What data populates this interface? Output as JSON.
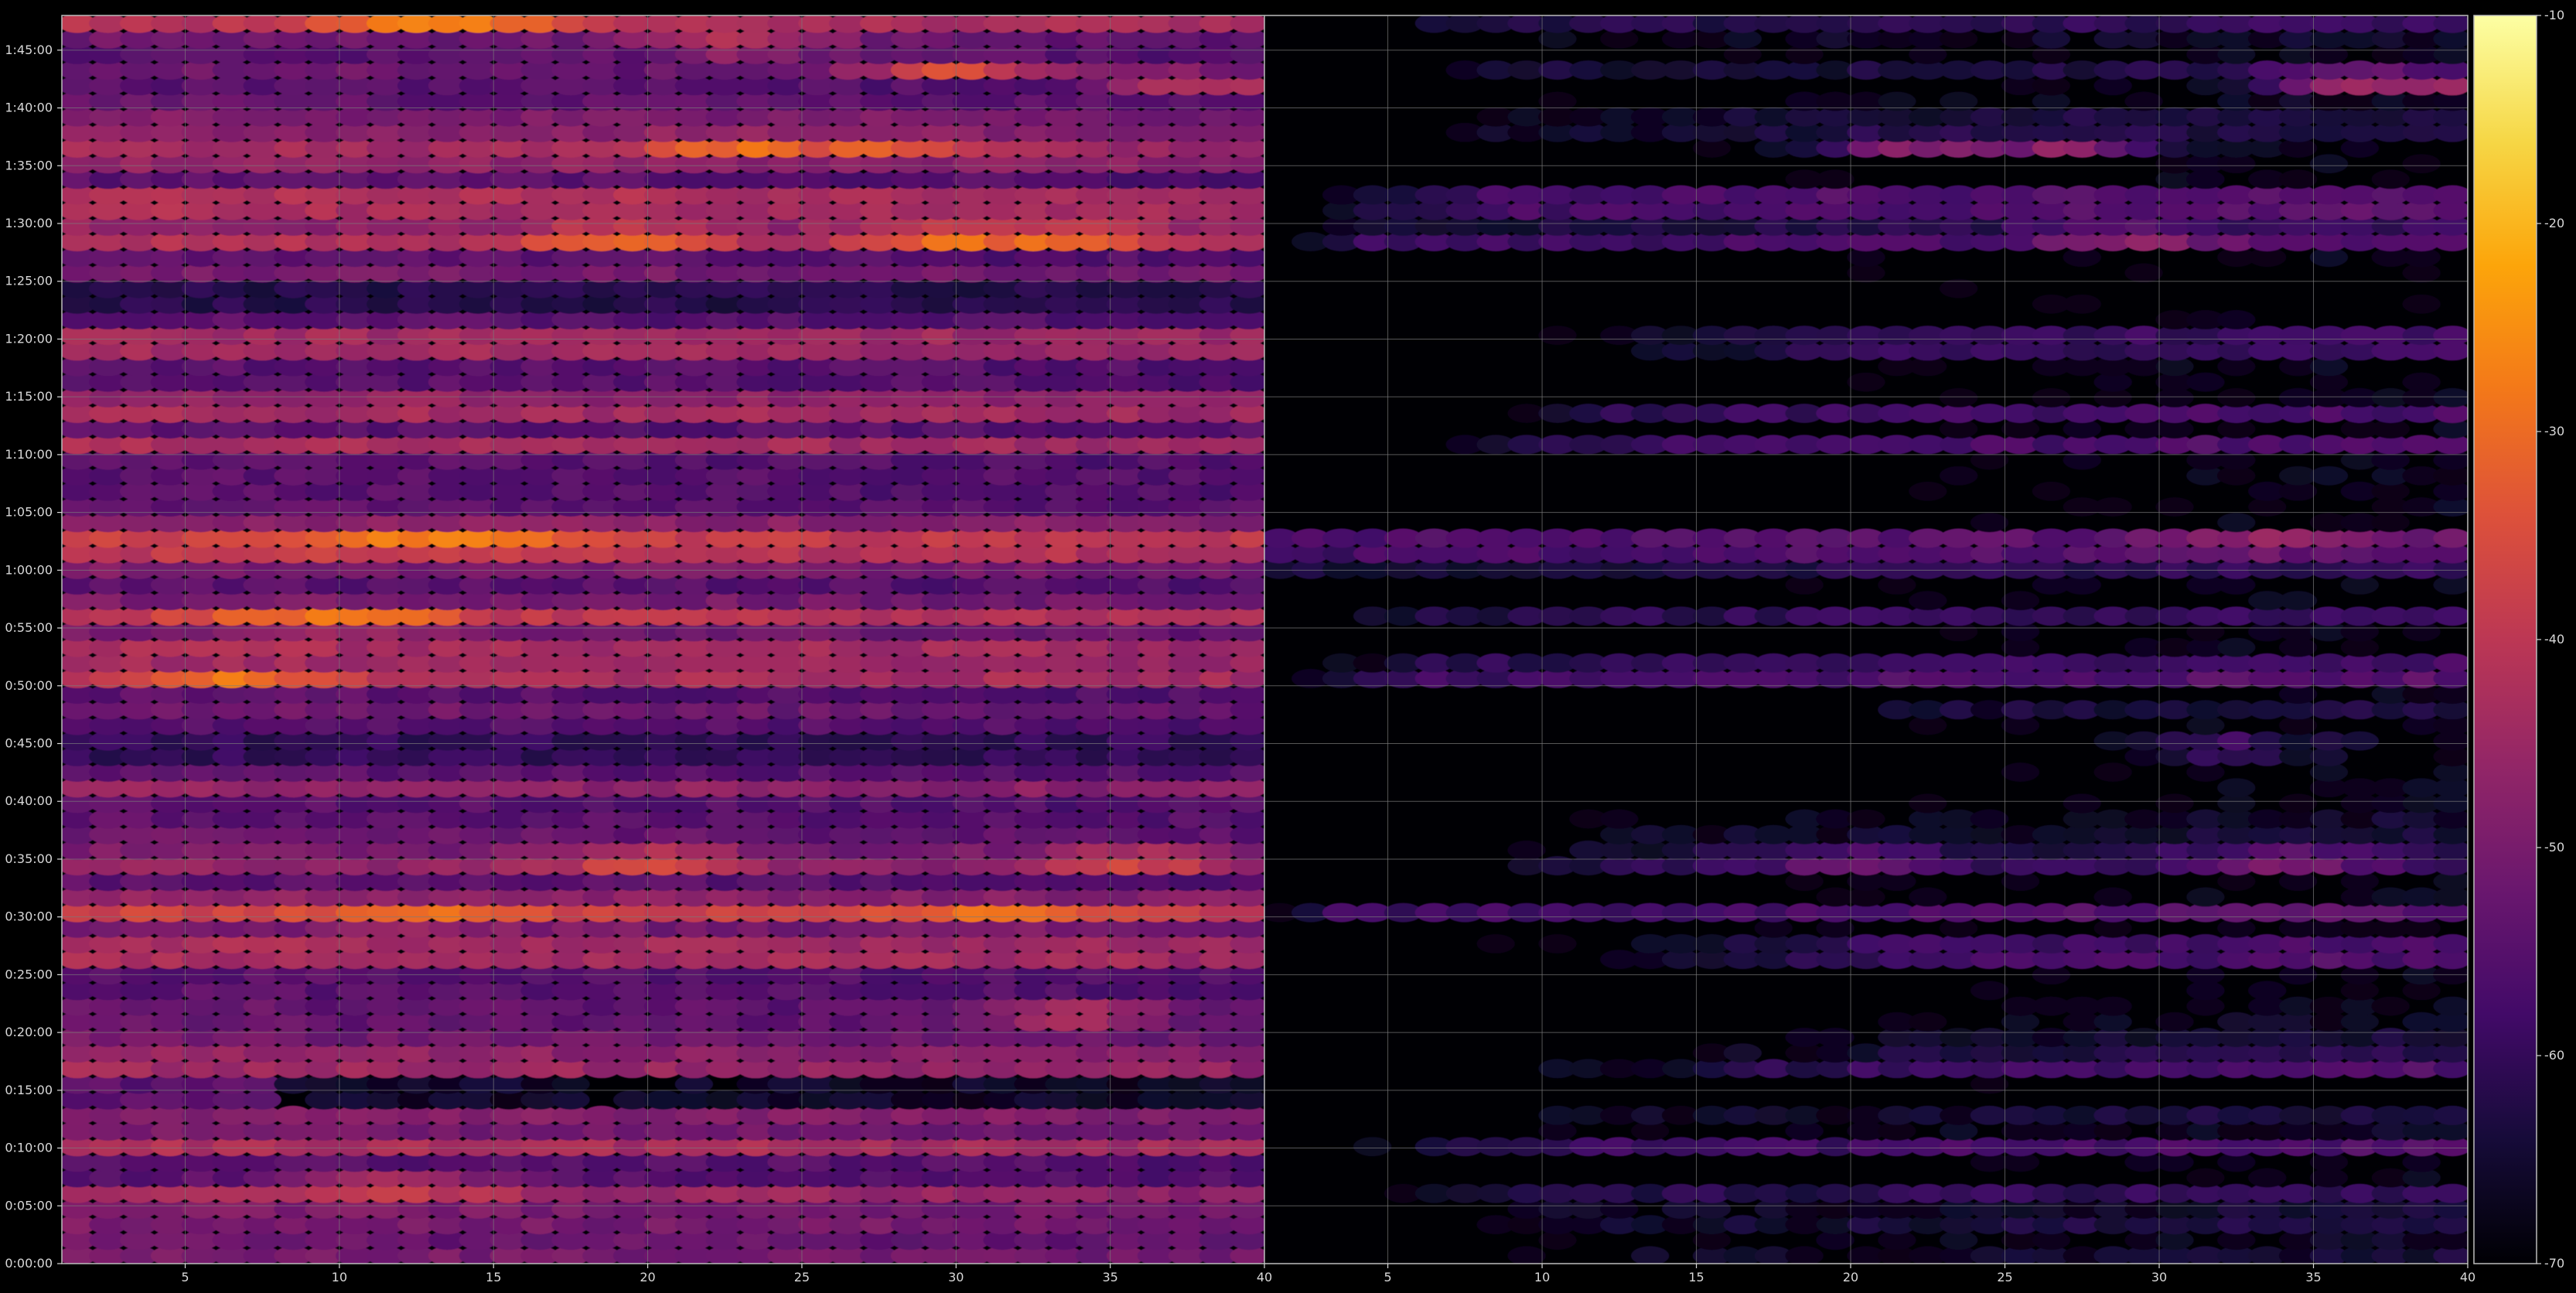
{
  "chart_data": {
    "type": "heatmap",
    "title": "",
    "xlabel": "",
    "ylabel": "",
    "colormap": "inferno",
    "background": "#000000",
    "grid": true,
    "grid_color": "#7a7a7a",
    "y_range_minutes": [
      0,
      108
    ],
    "y_ticks": [
      {
        "minutes": 0,
        "label": "0:00:00"
      },
      {
        "minutes": 5,
        "label": "0:05:00"
      },
      {
        "minutes": 10,
        "label": "0:10:00"
      },
      {
        "minutes": 15,
        "label": "0:15:00"
      },
      {
        "minutes": 20,
        "label": "0:20:00"
      },
      {
        "minutes": 25,
        "label": "0:25:00"
      },
      {
        "minutes": 30,
        "label": "0:30:00"
      },
      {
        "minutes": 35,
        "label": "0:35:00"
      },
      {
        "minutes": 40,
        "label": "0:40:00"
      },
      {
        "minutes": 45,
        "label": "0:45:00"
      },
      {
        "minutes": 50,
        "label": "0:50:00"
      },
      {
        "minutes": 55,
        "label": "0:55:00"
      },
      {
        "minutes": 60,
        "label": "1:00:00"
      },
      {
        "minutes": 65,
        "label": "1:05:00"
      },
      {
        "minutes": 70,
        "label": "1:10:00"
      },
      {
        "minutes": 75,
        "label": "1:15:00"
      },
      {
        "minutes": 80,
        "label": "1:20:00"
      },
      {
        "minutes": 85,
        "label": "1:25:00"
      },
      {
        "minutes": 90,
        "label": "1:30:00"
      },
      {
        "minutes": 95,
        "label": "1:35:00"
      },
      {
        "minutes": 100,
        "label": "1:40:00"
      },
      {
        "minutes": 105,
        "label": "1:45:00"
      }
    ],
    "panels": [
      {
        "name": "left",
        "x_range": [
          1,
          40
        ],
        "x_ticks": [
          "5",
          "10",
          "15",
          "20",
          "25",
          "30",
          "35",
          "40"
        ],
        "channels": 39,
        "base_level": -47,
        "bands": [
          {
            "t": 1.0,
            "v": -47
          },
          {
            "t": 2.5,
            "v": -46
          },
          {
            "t": 4.0,
            "v": -40
          },
          {
            "t": 5.5,
            "v": -36
          },
          {
            "t": 10.3,
            "v": -42
          },
          {
            "t": 12.2,
            "v": -38
          },
          {
            "t": 16.8,
            "v": -45
          },
          {
            "t": 18.8,
            "v": -38
          },
          {
            "t": 20.2,
            "v": -43
          },
          {
            "t": 21.6,
            "v": -42
          },
          {
            "t": 26.0,
            "v": -40
          },
          {
            "t": 27.4,
            "v": -41
          },
          {
            "t": 30.0,
            "v": -33
          },
          {
            "t": 31.5,
            "v": -46
          },
          {
            "t": 35.0,
            "v": -38
          },
          {
            "t": 36.4,
            "v": -40
          },
          {
            "t": 37.8,
            "v": -43
          },
          {
            "t": 41.0,
            "v": -46
          },
          {
            "t": 44.4,
            "v": -47
          },
          {
            "t": 46.0,
            "v": -50
          },
          {
            "t": 48.4,
            "v": -45
          },
          {
            "t": 50.4,
            "v": -41
          },
          {
            "t": 51.6,
            "v": -40
          },
          {
            "t": 53.2,
            "v": -43
          },
          {
            "t": 55.6,
            "v": -35
          },
          {
            "t": 57.0,
            "v": -46
          },
          {
            "t": 59.6,
            "v": -43
          },
          {
            "t": 61.0,
            "v": -35
          },
          {
            "t": 62.4,
            "v": -34
          },
          {
            "t": 63.8,
            "v": -44
          },
          {
            "t": 65.0,
            "v": -47
          },
          {
            "t": 67.4,
            "v": -49
          },
          {
            "t": 71.0,
            "v": -43
          },
          {
            "t": 73.4,
            "v": -43
          },
          {
            "t": 74.8,
            "v": -46
          },
          {
            "t": 78.6,
            "v": -40
          },
          {
            "t": 80.0,
            "v": -41
          },
          {
            "t": 85.6,
            "v": -50
          },
          {
            "t": 87.8,
            "v": -57
          },
          {
            "t": 89.0,
            "v": -33
          },
          {
            "t": 91.2,
            "v": -43
          },
          {
            "t": 92.4,
            "v": -42
          },
          {
            "t": 95.4,
            "v": -45
          },
          {
            "t": 96.8,
            "v": -42
          },
          {
            "t": 98.4,
            "v": -40
          },
          {
            "t": 99.8,
            "v": -40
          },
          {
            "t": 103.6,
            "v": -49
          },
          {
            "t": 105.4,
            "v": -45
          },
          {
            "t": 106.6,
            "v": -42
          },
          {
            "t": 107.6,
            "v": -40
          }
        ],
        "hotspots": [
          {
            "x": 12,
            "t": 107.6,
            "v": -28
          },
          {
            "x": 15,
            "t": 107.6,
            "v": -28
          },
          {
            "x": 23,
            "t": 105.4,
            "v": -30
          },
          {
            "x": 30,
            "t": 103.6,
            "v": -30
          },
          {
            "x": 38,
            "t": 102.4,
            "v": -30
          },
          {
            "x": 23,
            "t": 96.8,
            "v": -27
          },
          {
            "x": 28,
            "t": 96.8,
            "v": -30
          },
          {
            "x": 19,
            "t": 89.0,
            "v": -22
          },
          {
            "x": 30,
            "t": 89.0,
            "v": -20
          },
          {
            "x": 34,
            "t": 89.0,
            "v": -22
          },
          {
            "x": 12,
            "t": 62.4,
            "v": -24
          },
          {
            "x": 15,
            "t": 62.4,
            "v": -26
          },
          {
            "x": 8,
            "t": 55.6,
            "v": -28
          },
          {
            "x": 11,
            "t": 55.6,
            "v": -26
          },
          {
            "x": 7,
            "t": 50.4,
            "v": -28
          },
          {
            "x": 20,
            "t": 35.0,
            "v": -25
          },
          {
            "x": 36,
            "t": 35.0,
            "v": -26
          },
          {
            "x": 13,
            "t": 30.0,
            "v": -25
          },
          {
            "x": 31,
            "t": 30.0,
            "v": -26
          },
          {
            "x": 34,
            "t": 21.6,
            "v": -30
          },
          {
            "x": 12,
            "t": 6.8,
            "v": -28
          }
        ],
        "dark_gaps": [
          {
            "t0": 13.8,
            "t1": 16.4,
            "x0": 8,
            "x1": 40,
            "v": -66
          },
          {
            "t0": 43.2,
            "t1": 45.6,
            "x0": 1,
            "x1": 40,
            "v": -60
          },
          {
            "t0": 82.0,
            "t1": 85.0,
            "x0": 1,
            "x1": 40,
            "v": -62
          }
        ]
      },
      {
        "name": "right",
        "x_range": [
          1,
          40
        ],
        "x_ticks": [
          "5",
          "10",
          "15",
          "20",
          "25",
          "30",
          "35",
          "40"
        ],
        "channels": 39,
        "base_level": -58,
        "bands": [
          {
            "t": 1.0,
            "v": -63
          },
          {
            "t": 2.5,
            "v": -62
          },
          {
            "t": 4.0,
            "v": -54
          },
          {
            "t": 5.5,
            "v": -52
          },
          {
            "t": 10.3,
            "v": -57
          },
          {
            "t": 12.2,
            "v": -55
          },
          {
            "t": 16.8,
            "v": -58
          },
          {
            "t": 18.8,
            "v": -54
          },
          {
            "t": 20.2,
            "v": -56
          },
          {
            "t": 26.0,
            "v": -55
          },
          {
            "t": 27.4,
            "v": -56
          },
          {
            "t": 30.0,
            "v": -52
          },
          {
            "t": 35.0,
            "v": -52
          },
          {
            "t": 36.4,
            "v": -53
          },
          {
            "t": 37.8,
            "v": -56
          },
          {
            "t": 48.4,
            "v": -58
          },
          {
            "t": 50.4,
            "v": -55
          },
          {
            "t": 51.6,
            "v": -55
          },
          {
            "t": 55.6,
            "v": -55
          },
          {
            "t": 59.6,
            "v": -55
          },
          {
            "t": 61.0,
            "v": -50
          },
          {
            "t": 62.4,
            "v": -50
          },
          {
            "t": 71.0,
            "v": -57
          },
          {
            "t": 73.4,
            "v": -58
          },
          {
            "t": 78.6,
            "v": -56
          },
          {
            "t": 80.0,
            "v": -57
          },
          {
            "t": 89.0,
            "v": -48
          },
          {
            "t": 91.2,
            "v": -56
          },
          {
            "t": 92.4,
            "v": -56
          },
          {
            "t": 98.4,
            "v": -56
          },
          {
            "t": 99.8,
            "v": -55
          },
          {
            "t": 103.6,
            "v": -60
          },
          {
            "t": 105.4,
            "v": -58
          },
          {
            "t": 106.6,
            "v": -58
          },
          {
            "t": 107.6,
            "v": -59
          }
        ],
        "hotspots": [
          {
            "x": 36,
            "t": 102.4,
            "v": -40
          },
          {
            "x": 39,
            "t": 102.4,
            "v": -38
          },
          {
            "x": 22,
            "t": 96.8,
            "v": -45
          },
          {
            "x": 27,
            "t": 96.8,
            "v": -45
          },
          {
            "x": 29,
            "t": 89.0,
            "v": -42
          },
          {
            "x": 34,
            "t": 62.4,
            "v": -44
          },
          {
            "x": 20,
            "t": 35.0,
            "v": -44
          },
          {
            "x": 34,
            "t": 35.0,
            "v": -44
          },
          {
            "x": 32,
            "t": 44.6,
            "v": -48
          }
        ],
        "fade_in": [
          {
            "t0": 0,
            "t1": 14.4,
            "x_start": 10
          },
          {
            "t0": 14.4,
            "t1": 28.0,
            "x_start": 22
          },
          {
            "t0": 28.0,
            "t1": 32.0,
            "x_start": 3
          },
          {
            "t0": 32.0,
            "t1": 40.0,
            "x_start": 12
          },
          {
            "t0": 40.0,
            "t1": 48.0,
            "x_start": 23
          },
          {
            "t0": 48.0,
            "t1": 58.0,
            "x_start": 6
          },
          {
            "t0": 58.0,
            "t1": 64.0,
            "x_start": 1
          },
          {
            "t0": 64.0,
            "t1": 76.0,
            "x_start": 14
          },
          {
            "t0": 76.0,
            "t1": 87.0,
            "x_start": 21
          },
          {
            "t0": 87.0,
            "t1": 90.5,
            "x_start": 4
          },
          {
            "t0": 90.5,
            "t1": 108.0,
            "x_start": 8
          }
        ],
        "dark_gaps": [
          {
            "t0": 13.8,
            "t1": 16.4,
            "x0": 1,
            "x1": 40,
            "v": -70
          },
          {
            "t0": 40.5,
            "t1": 48.0,
            "x0": 1,
            "x1": 20,
            "v": -70
          },
          {
            "t0": 82.0,
            "t1": 87.0,
            "x0": 1,
            "x1": 40,
            "v": -70
          }
        ]
      }
    ],
    "colorbar": {
      "range": [
        -70,
        -10
      ],
      "ticks": [
        "-10",
        "-20",
        "-30",
        "-40",
        "-50",
        "-60",
        "-70"
      ],
      "tick_values": [
        -10,
        -20,
        -30,
        -40,
        -50,
        -60,
        -70
      ]
    }
  }
}
